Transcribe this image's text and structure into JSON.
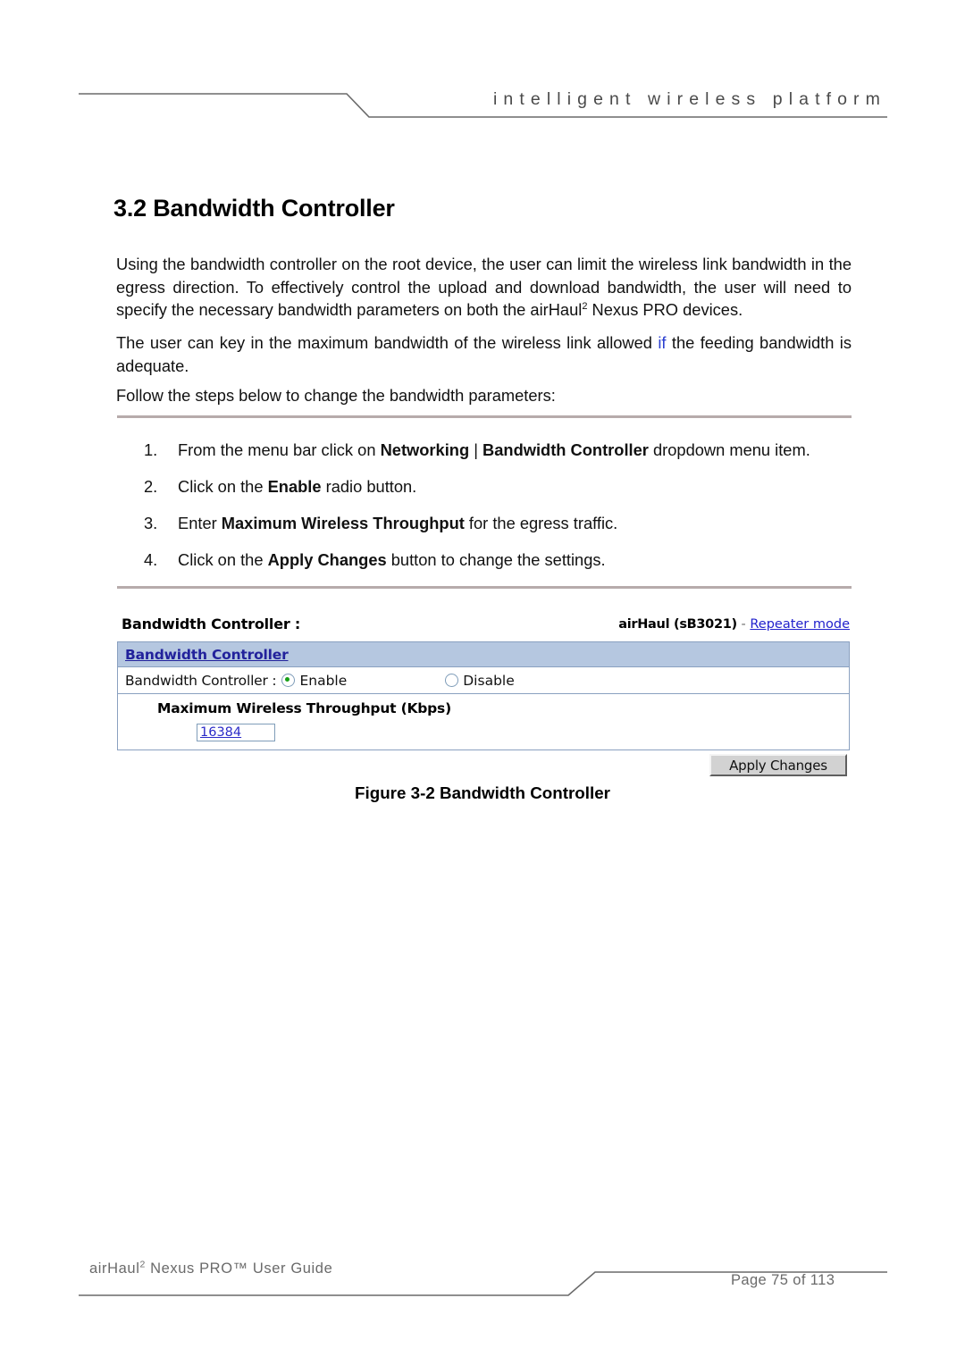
{
  "header": {
    "tagline": "intelligent   wireless   platform"
  },
  "section": {
    "title": "3.2 Bandwidth Controller"
  },
  "paragraphs": {
    "p1_a": "Using the bandwidth controller on the root device, the user can limit the wireless link bandwidth in the egress direction. To effectively control the upload and download bandwidth, the user will need to specify the necessary bandwidth parameters on both the airHaul",
    "p1_sup": "2",
    "p1_b": " Nexus PRO devices.",
    "p2_a": "The user can key in the maximum bandwidth of the wireless link allowed ",
    "p2_blue": "if",
    "p2_b": " the feeding bandwidth is adequate.",
    "p3": "Follow the steps below to change the bandwidth parameters:"
  },
  "steps": [
    {
      "num": "1.",
      "pre": "From the menu bar click on ",
      "bold1": "Networking",
      "mid": " | ",
      "bold2": "Bandwidth Controller",
      "post": " dropdown menu item."
    },
    {
      "num": "2.",
      "pre": "Click on the ",
      "bold1": "Enable",
      "mid": "",
      "bold2": "",
      "post": " radio button."
    },
    {
      "num": "3.",
      "pre": "Enter ",
      "bold1": "Maximum Wireless Throughput",
      "mid": "",
      "bold2": "",
      "post": " for the egress traffic."
    },
    {
      "num": "4.",
      "pre": "Click on the ",
      "bold1": "Apply Changes",
      "mid": "",
      "bold2": "",
      "post": " button to change the settings."
    }
  ],
  "ui": {
    "topbar_left": "Bandwidth Controller :",
    "device_name": "airHaul (sB3021)",
    "dash": " - ",
    "mode_link": "Repeater mode",
    "panel_title": "Bandwidth Controller",
    "row_label": "Bandwidth Controller :",
    "radio_enable": "Enable",
    "radio_disable": "Disable",
    "radio_selected": "Enable",
    "throughput_label": "Maximum Wireless Throughput (Kbps)",
    "throughput_value": "16384",
    "apply_button": "Apply Changes",
    "accent_header": "#b5c7e0",
    "border_color": "#8aa0c0",
    "link_color": "#2222cc",
    "radio_dot_color": "#17a017"
  },
  "figure": {
    "caption": "Figure 3-2 Bandwidth Controller"
  },
  "footer": {
    "guide_a": "airHaul",
    "guide_sup": "2",
    "guide_b": " Nexus PRO™ User Guide",
    "page": "Page 75 of 113"
  }
}
